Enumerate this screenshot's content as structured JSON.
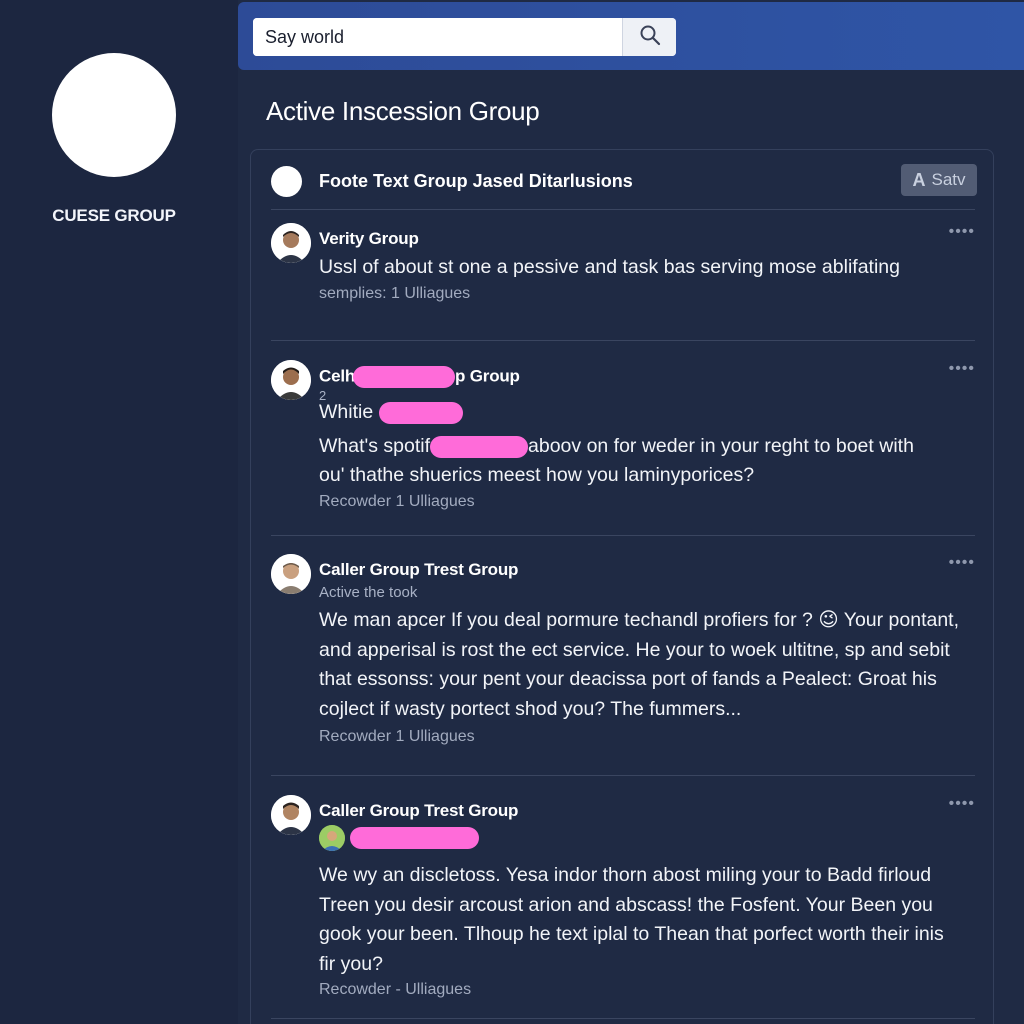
{
  "sidebar": {
    "group_name": "CUESE GROUP"
  },
  "search": {
    "value": "Say world",
    "icon": "search-icon"
  },
  "page_title": "Active Inscession Group",
  "panel": {
    "title": "Foote Text Group Jased Ditarlusions",
    "save_label": "Satv",
    "save_glyph": "A"
  },
  "posts": [
    {
      "author": "Verity Group",
      "more": "••••",
      "body": "Ussl of about st one a pessive and task bas serving mose ablifating",
      "meta": "semplies:  1 Ulliagues"
    },
    {
      "author_start": "Celh",
      "author_end": "p Group",
      "sub_number": "2",
      "sub_line": "Whitie",
      "more": "••••",
      "body_start": "What's spotif",
      "body_mid": "aboov on for weder in your reght to boet with",
      "body_end": "ou' thathe shuerics meest how you laminyporices?",
      "meta": "Recowder 1 Ulliagues"
    },
    {
      "author": "Caller Group Trest Group",
      "sub": "Active the took",
      "more": "••••",
      "body_before_emoji": "We man apcer  If you deal pormure techandl profiers for ?",
      "emoji": "😉",
      "body_after_emoji": " Your pontant, and apperisal is rost the ect service. He your to woek ultitne, sp and sebit that essonss: your pent your deacissa port of fands a Pealect: Groat his cojlect if wasty portect shod you? The fummers...",
      "meta": "Recowder 1 Ulliagues"
    },
    {
      "author": "Caller Group Trest Group",
      "more": "••••",
      "body": "We wy an discletoss. Yesa indor thorn abost miling your to Badd firloud  Treen you desir arcoust arion and abscass! the Fosfent. Your Been you gook your been. Tlhoup he text iplal to Thean that porfect worth their inis fir you?",
      "meta": "Recowder - Ulliagues"
    }
  ],
  "colors": {
    "background": "#1f2a44",
    "topbar": "#2f55a6",
    "redaction": "#ff6bd9"
  }
}
